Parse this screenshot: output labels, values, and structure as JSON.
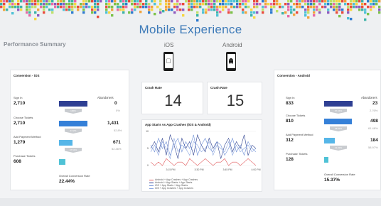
{
  "header": {
    "title": "Mobile Experience"
  },
  "section": {
    "title": "Performance Summary"
  },
  "platforms": {
    "ios": "iOS",
    "android": "Android"
  },
  "ios_funnel": {
    "title": "Conversion - iOS",
    "abandoners_label": "Abandoners",
    "steps": [
      {
        "label": "Sign In",
        "value": "2,710",
        "abandon": "0",
        "abandon_pct": "0%",
        "bar_pct": 100,
        "chev": "100%"
      },
      {
        "label": "Choose Tickets",
        "value": "2,710",
        "abandon": "1,431",
        "abandon_pct": "52.8%",
        "bar_pct": 100,
        "chev": "47.2%"
      },
      {
        "label": "Add Payment Method",
        "value": "1,279",
        "abandon": "671",
        "abandon_pct": "52.46%",
        "bar_pct": 47.2,
        "chev": "47.54%"
      },
      {
        "label": "Purchase Tickets",
        "value": "608",
        "abandon": "",
        "abandon_pct": "",
        "bar_pct": 22.44,
        "chev": ""
      }
    ],
    "overall_label": "Overall Conversion Rate",
    "overall_value": "22.44%"
  },
  "android_funnel": {
    "title": "Conversion - Android",
    "abandoners_label": "Abandoners",
    "steps": [
      {
        "label": "Sign In",
        "value": "833",
        "abandon": "23",
        "abandon_pct": "2.76%",
        "bar_pct": 100,
        "chev": "97.24%"
      },
      {
        "label": "Choose Tickets",
        "value": "810",
        "abandon": "498",
        "abandon_pct": "61.48%",
        "bar_pct": 97.2,
        "chev": "38.52%"
      },
      {
        "label": "Add Payment Method",
        "value": "312",
        "abandon": "184",
        "abandon_pct": "58.97%",
        "bar_pct": 37.5,
        "chev": "41.03%"
      },
      {
        "label": "Purchase Tickets",
        "value": "128",
        "abandon": "",
        "abandon_pct": "",
        "bar_pct": 15.37,
        "chev": ""
      }
    ],
    "overall_label": "Overall Conversion Rate",
    "overall_value": "15.37%"
  },
  "crash_ios": {
    "title": "Crash Rate",
    "value": "14"
  },
  "crash_android": {
    "title": "Crash Rate",
    "value": "15"
  },
  "chart_data": {
    "type": "line",
    "title": "App Starts vs App Crashes (iOS & Android)",
    "x_ticks": [
      "3:15 PM",
      "3:30 PM",
      "3:45 PM",
      "4:00 PM"
    ],
    "y_ticks": [
      0,
      5,
      10
    ],
    "ylim": [
      0,
      10
    ],
    "series": [
      {
        "name": "Android + App Crashes + App Crashes",
        "color": "#e15759",
        "values": [
          1,
          0,
          1,
          0,
          2,
          1,
          0,
          1,
          1,
          0,
          2,
          1,
          0,
          1,
          2,
          1,
          0,
          1,
          1,
          2,
          0,
          1,
          1,
          0,
          1,
          2,
          1,
          0
        ]
      },
      {
        "name": "Android + App Starts + App Starts",
        "color": "#2b3f8f",
        "values": [
          5,
          7,
          4,
          8,
          3,
          9,
          6,
          2,
          8,
          5,
          7,
          3,
          9,
          6,
          4,
          8,
          5,
          7,
          2,
          6,
          8,
          4,
          7,
          5,
          9,
          3,
          6,
          5
        ]
      },
      {
        "name": "iOS + App Starts + App Starts",
        "color": "#6e8fd6",
        "values": [
          6,
          4,
          8,
          5,
          7,
          3,
          6,
          8,
          4,
          7,
          5,
          9,
          3,
          6,
          8,
          5,
          4,
          7,
          6,
          3,
          5,
          8,
          4,
          6,
          3,
          7,
          5,
          4
        ]
      },
      {
        "name": "iOS + App Crashes + App Crashes",
        "color": "#8aa6e0",
        "values": [
          4,
          6,
          3,
          7,
          5,
          2,
          8,
          4,
          6,
          5,
          3,
          7,
          6,
          4,
          5,
          7,
          3,
          6,
          5,
          4,
          7,
          3,
          6,
          4,
          5,
          6,
          4,
          5
        ]
      }
    ]
  },
  "colors": {
    "accent": "#3d7ab8",
    "bar_dark": "#2e3f93",
    "bar_mid": "#3580d8",
    "bar_light": "#56b6e8",
    "bar_teal": "#4fc2d6"
  }
}
